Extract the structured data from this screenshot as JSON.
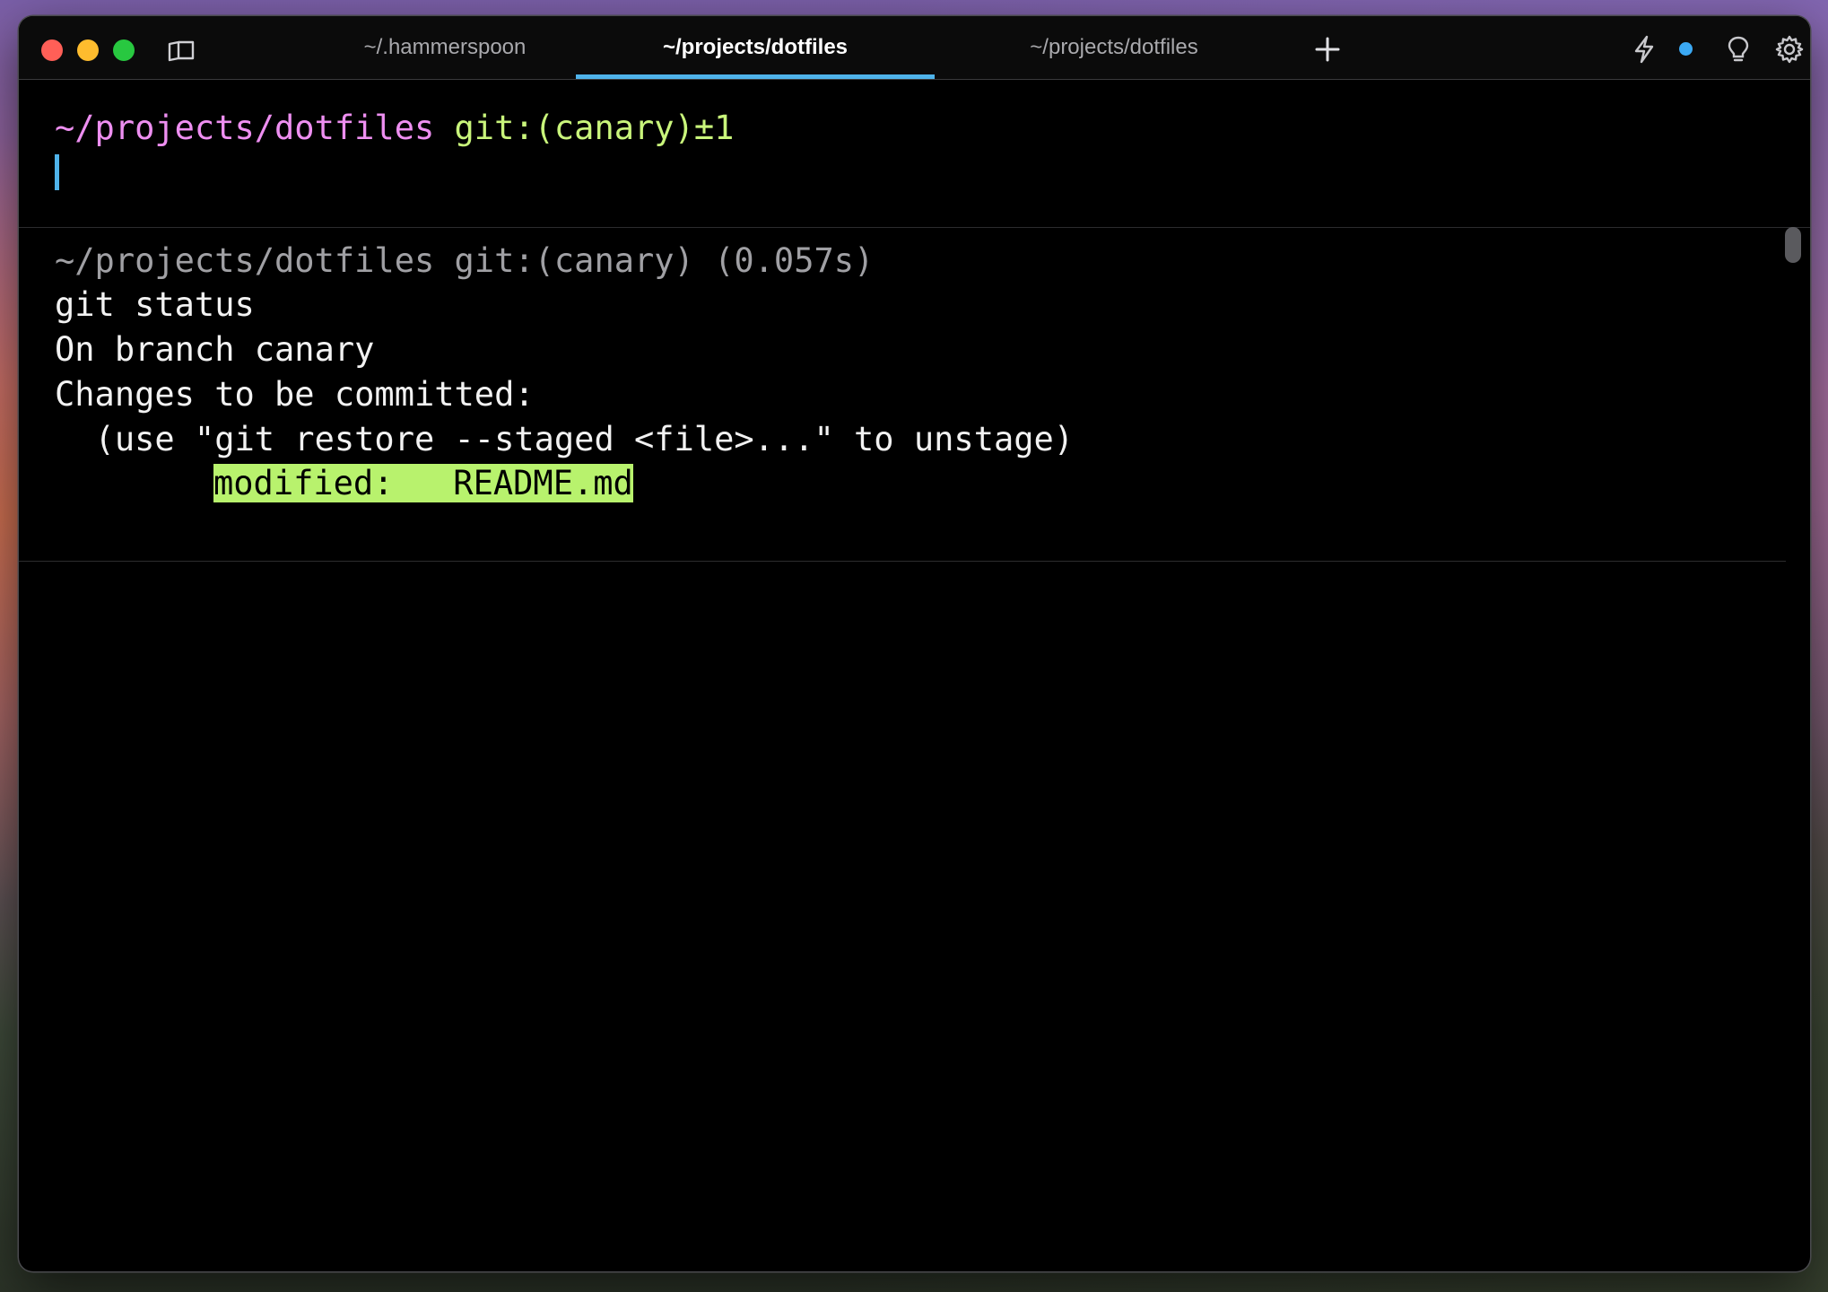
{
  "window": {
    "tabs": [
      {
        "label": "~/.hammerspoon",
        "active": false
      },
      {
        "label": "~/projects/dotfiles",
        "active": true
      },
      {
        "label": "~/projects/dotfiles",
        "active": false
      }
    ],
    "icons": [
      "sidebar-icon",
      "plus-icon",
      "lightning-icon",
      "lightbulb-icon",
      "gear-icon"
    ],
    "accent_color": "#4fb3ea"
  },
  "prompt": {
    "path": "~/projects/dotfiles",
    "git": "git:(canary)±1"
  },
  "block": {
    "header": "~/projects/dotfiles git:(canary) (0.057s)",
    "command": "git status",
    "lines": [
      "On branch canary",
      "Changes to be committed:",
      "  (use \"git restore --staged <file>...\" to unstage)"
    ],
    "highlighted": "modified:   README.md"
  }
}
